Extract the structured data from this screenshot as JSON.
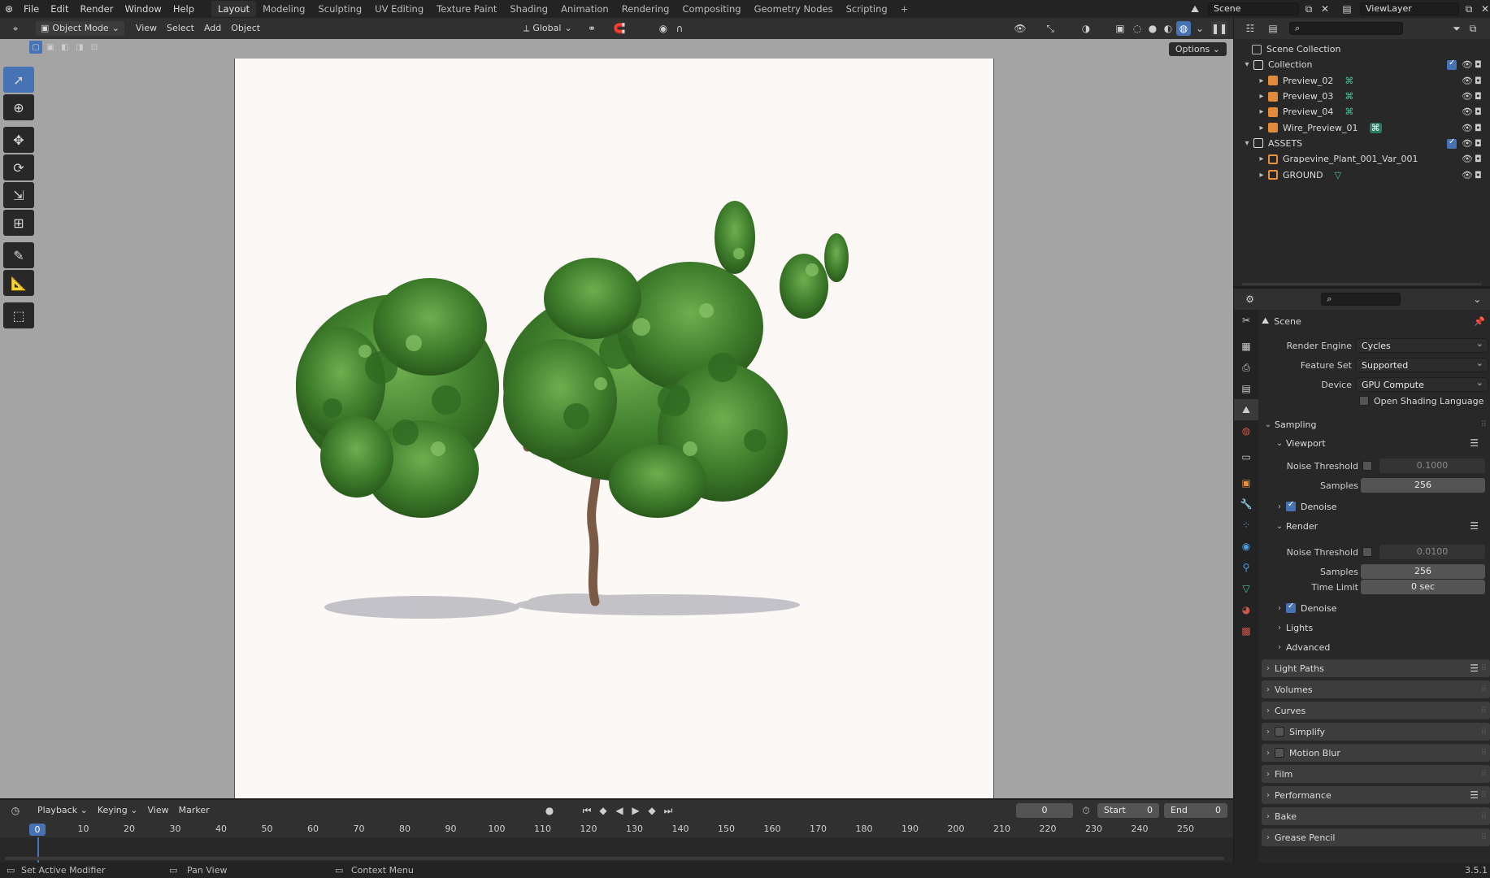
{
  "topbar": {
    "menus": [
      "File",
      "Edit",
      "Render",
      "Window",
      "Help"
    ],
    "workspaces": [
      "Layout",
      "Modeling",
      "Sculpting",
      "UV Editing",
      "Texture Paint",
      "Shading",
      "Animation",
      "Rendering",
      "Compositing",
      "Geometry Nodes",
      "Scripting"
    ],
    "active_workspace": "Layout",
    "add_workspace": "+",
    "scene_name": "Scene",
    "view_layer": "ViewLayer"
  },
  "viewport_header": {
    "mode": "Object Mode",
    "menus": [
      "View",
      "Select",
      "Add",
      "Object"
    ],
    "orientation": "Global",
    "options": "Options"
  },
  "outliner": {
    "items": [
      {
        "label": "Scene Collection",
        "type": "scene"
      },
      {
        "label": "Collection",
        "type": "collection"
      },
      {
        "label": "Preview_02",
        "type": "camera"
      },
      {
        "label": "Preview_03",
        "type": "camera"
      },
      {
        "label": "Preview_04",
        "type": "camera"
      },
      {
        "label": "Wire_Preview_01",
        "type": "camera"
      },
      {
        "label": "ASSETS",
        "type": "collection"
      },
      {
        "label": "Grapevine_Plant_001_Var_001",
        "type": "mesh"
      },
      {
        "label": "GROUND",
        "type": "mesh"
      }
    ]
  },
  "properties": {
    "context": "Scene",
    "render_engine_label": "Render Engine",
    "render_engine": "Cycles",
    "feature_set_label": "Feature Set",
    "feature_set": "Supported",
    "device_label": "Device",
    "device": "GPU Compute",
    "osl_label": "Open Shading Language",
    "sampling": "Sampling",
    "viewport": "Viewport",
    "noise_threshold_label": "Noise Threshold",
    "viewport_noise": "0.1000",
    "samples_label": "Samples",
    "viewport_samples": "256",
    "denoise_label": "Denoise",
    "render": "Render",
    "render_noise": "0.0100",
    "render_samples": "256",
    "time_limit_label": "Time Limit",
    "time_limit": "0 sec",
    "lights": "Lights",
    "advanced": "Advanced",
    "panels": [
      "Light Paths",
      "Volumes",
      "Curves",
      "Simplify",
      "Motion Blur",
      "Film",
      "Performance",
      "Bake",
      "Grease Pencil"
    ]
  },
  "timeline": {
    "menus": [
      "Playback",
      "Keying",
      "View",
      "Marker"
    ],
    "current_frame": "0",
    "start_label": "Start",
    "start": "0",
    "end_label": "End",
    "end": "0",
    "ticks": [
      "0",
      "10",
      "20",
      "30",
      "40",
      "50",
      "60",
      "70",
      "80",
      "90",
      "100",
      "110",
      "120",
      "130",
      "140",
      "150",
      "160",
      "170",
      "180",
      "190",
      "200",
      "210",
      "220",
      "230",
      "240",
      "250"
    ]
  },
  "statusbar": {
    "left": "Set Active Modifier",
    "mid": "Pan View",
    "right": "Context Menu",
    "version": "3.5.1"
  },
  "colors": {
    "accent": "#4772b3",
    "camera_icon": "#e08a3a",
    "mesh_icon": "#e8913c",
    "data_icon": "#4cc59a"
  }
}
